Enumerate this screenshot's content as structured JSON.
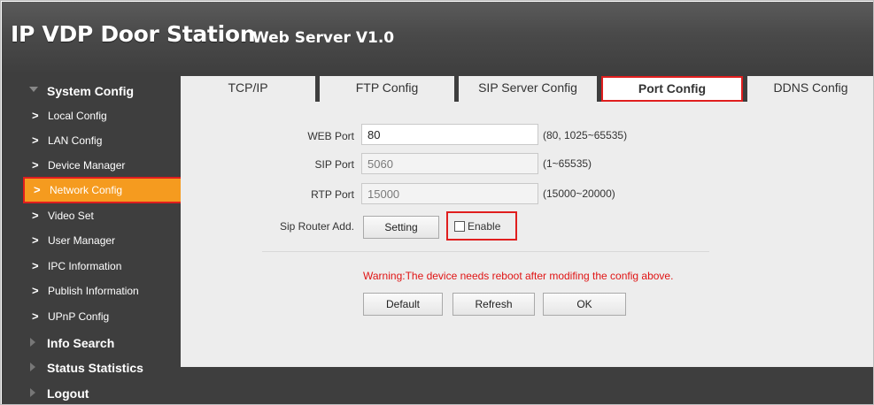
{
  "header": {
    "title": "IP VDP Door Station",
    "subtitle": "Web Server V1.0"
  },
  "sidebar": {
    "system_config": "System Config",
    "items": [
      {
        "label": "Local Config"
      },
      {
        "label": "LAN Config"
      },
      {
        "label": "Device Manager"
      },
      {
        "label": "Network Config"
      },
      {
        "label": "Video Set"
      },
      {
        "label": "User Manager"
      },
      {
        "label": "IPC Information"
      },
      {
        "label": "Publish Information"
      },
      {
        "label": "UPnP Config"
      }
    ],
    "chevron": ">",
    "info_search": "Info Search",
    "status_statistics": "Status Statistics",
    "logout": "Logout",
    "active_item": "Network Config"
  },
  "tabs": [
    {
      "label": "TCP/IP"
    },
    {
      "label": "FTP Config"
    },
    {
      "label": "SIP Server Config"
    },
    {
      "label": "Port Config"
    },
    {
      "label": "DDNS Config"
    }
  ],
  "active_tab": "Port Config",
  "form": {
    "web_port": {
      "label": "WEB Port",
      "value": "80",
      "hint": "(80, 1025~65535)"
    },
    "sip_port": {
      "label": "SIP Port",
      "value": "5060",
      "hint": "(1~65535)"
    },
    "rtp_port": {
      "label": "RTP Port",
      "value": "15000",
      "hint": "(15000~20000)"
    },
    "sip_router": {
      "label": "Sip Router Add.",
      "setting_button": "Setting",
      "enable_label": "Enable",
      "enabled": false
    }
  },
  "warning": "Warning:The device needs reboot after modifing the config above.",
  "buttons": {
    "default": "Default",
    "refresh": "Refresh",
    "ok": "OK"
  },
  "colors": {
    "highlight": "#e01e1e",
    "active_item": "#f59b1f",
    "warning": "#e01414",
    "dark_bg": "#3e3e3e"
  }
}
